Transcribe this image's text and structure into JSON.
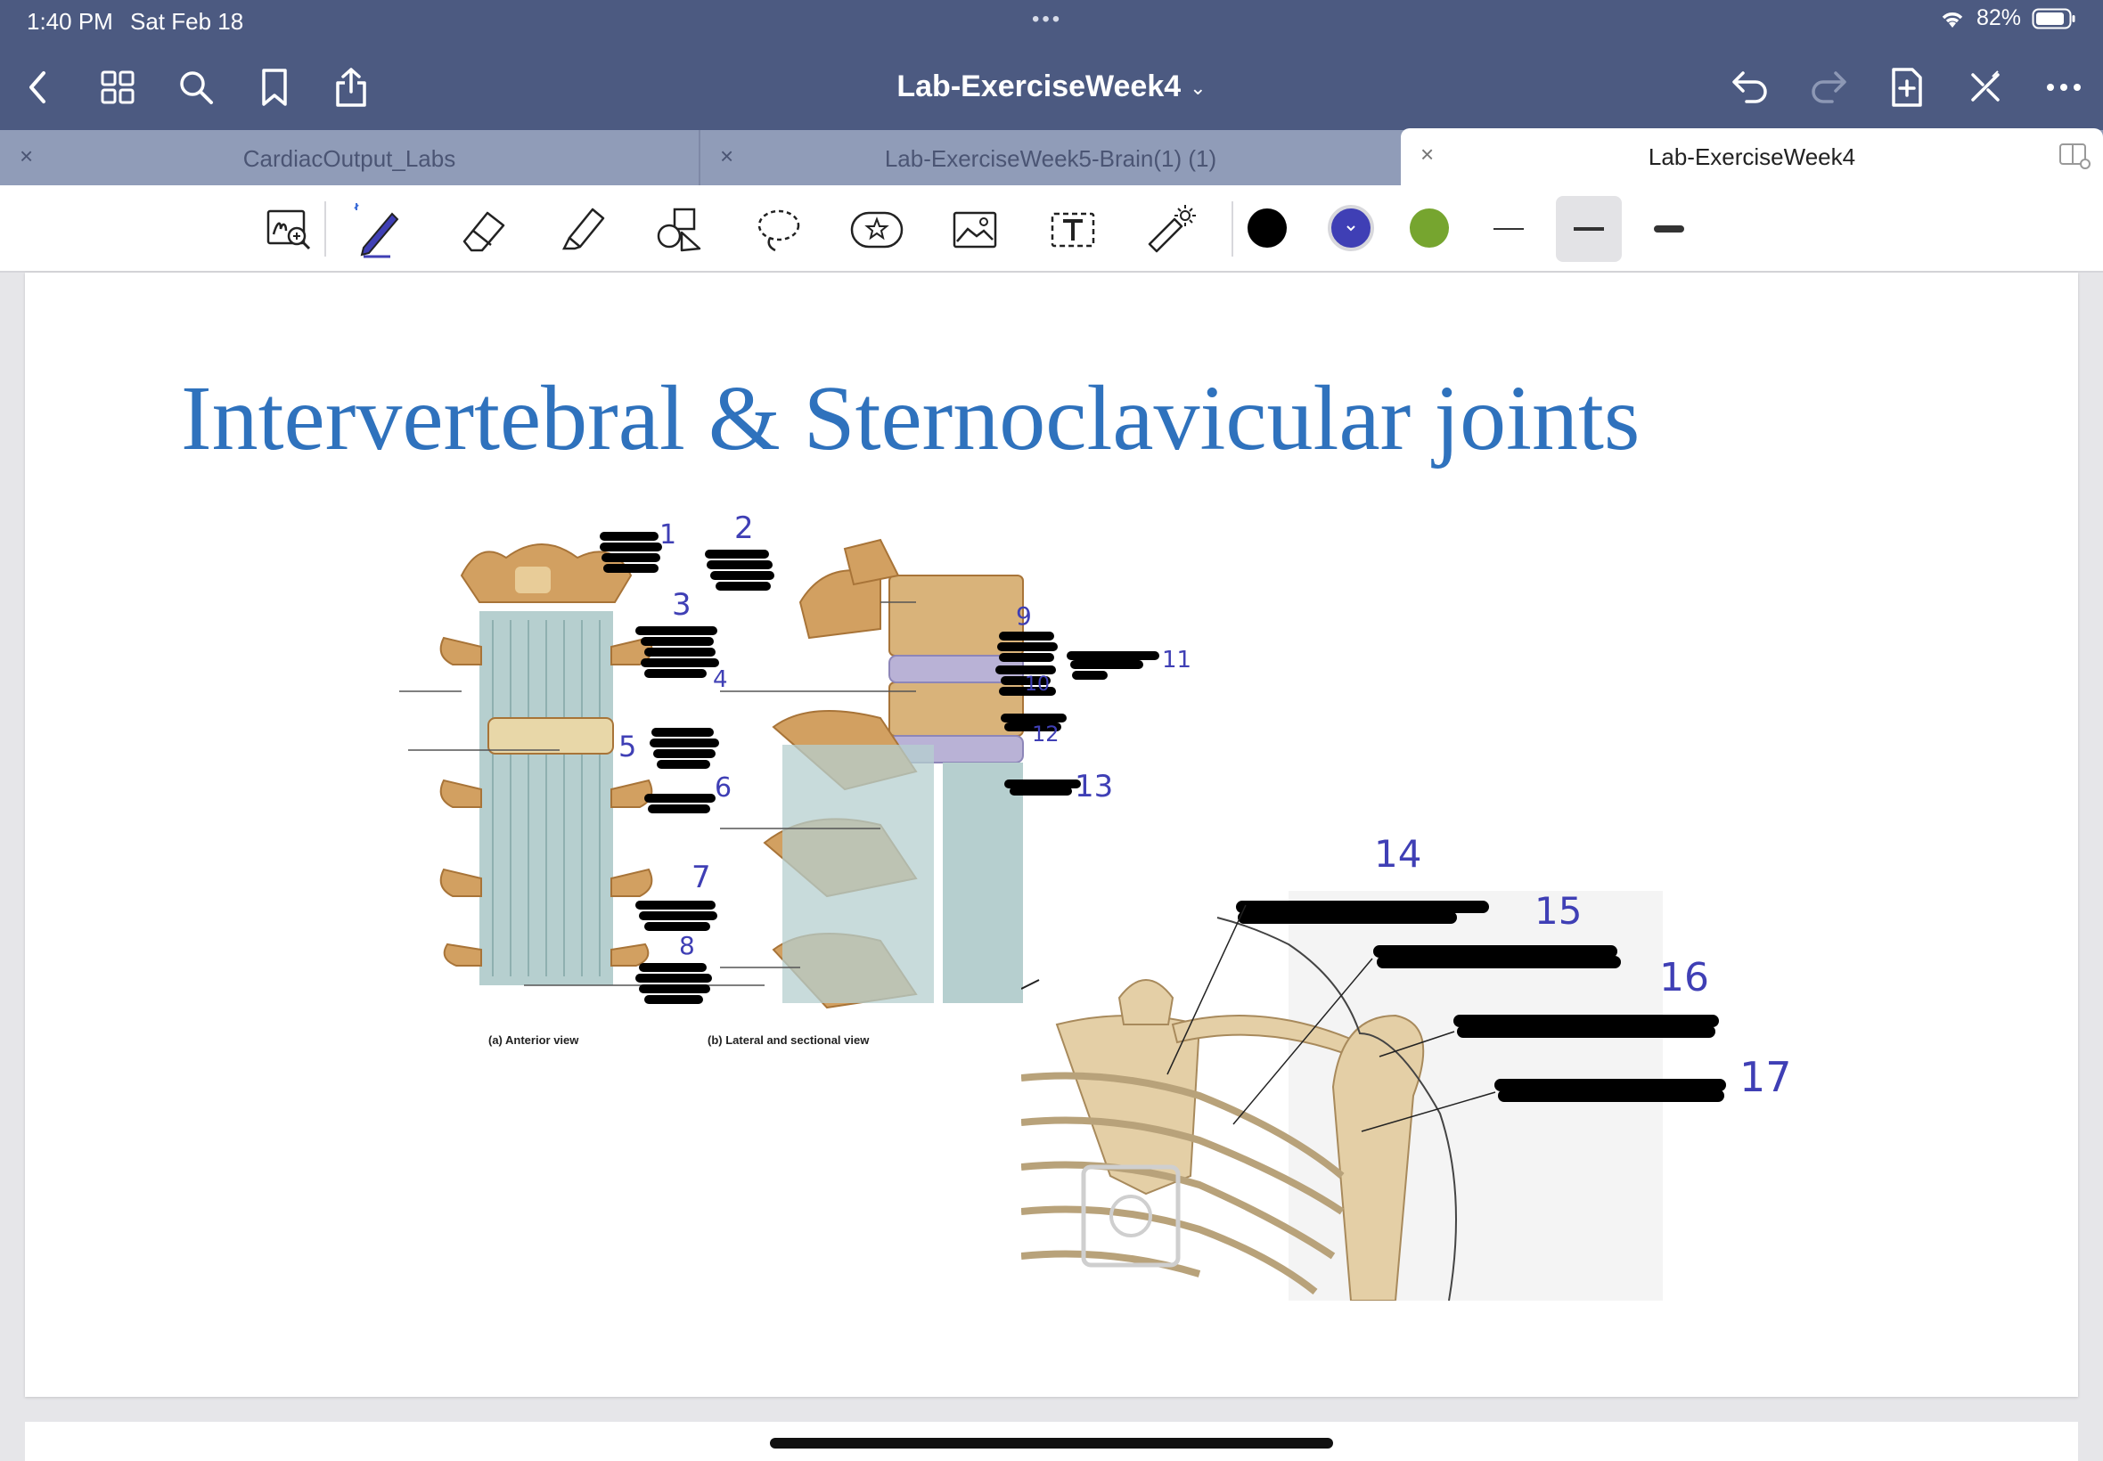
{
  "status": {
    "time": "1:40 PM",
    "date": "Sat Feb 18",
    "battery": "82%"
  },
  "nav": {
    "title": "Lab-ExerciseWeek4"
  },
  "tabs": [
    {
      "label": "CardiacOutput_Labs"
    },
    {
      "label": "Lab-ExerciseWeek5-Brain(1) (1)"
    },
    {
      "label": "Lab-ExerciseWeek4"
    }
  ],
  "toolbar": {
    "tools": [
      "zoom-write-icon",
      "pen-icon",
      "eraser-icon",
      "highlighter-icon",
      "shapes-icon",
      "lasso-icon",
      "sticker-icon",
      "image-icon",
      "text-tool-icon",
      "laser-pointer-icon"
    ],
    "colors": [
      "#000000",
      "#3f3fb5",
      "#76a52f"
    ],
    "selected_color": "#3f3fb5",
    "stroke_widths": [
      "thin",
      "medium",
      "thick"
    ],
    "selected_stroke": "medium"
  },
  "slide": {
    "title": "Intervertebral & Sternoclavicular joints",
    "captions": {
      "anterior": "(a) Anterior view",
      "lateral": "(b) Lateral and sectional view"
    },
    "labels": [
      "1",
      "2",
      "3",
      "4",
      "5",
      "6",
      "7",
      "8",
      "9",
      "10",
      "11",
      "12",
      "13",
      "14",
      "15",
      "16",
      "17"
    ]
  }
}
